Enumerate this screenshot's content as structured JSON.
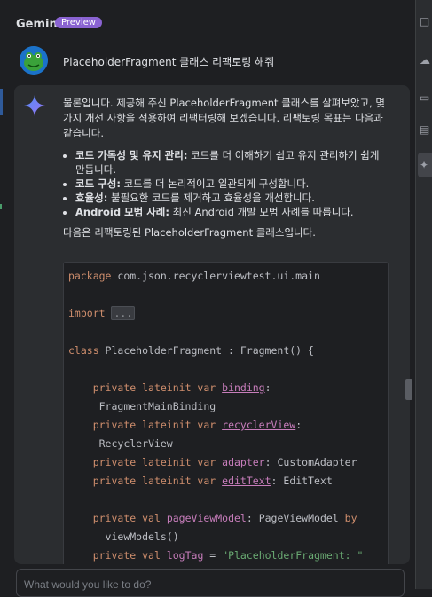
{
  "header": {
    "title": "Gemini",
    "badge": "Preview"
  },
  "user_message": "PlaceholderFragment 클래스 리팩토링 해줘",
  "answer": {
    "intro": "물론입니다. 제공해 주신 PlaceholderFragment 클래스를 살펴보았고, 몇 가지 개선 사항을 적용하여 리팩터링해 보겠습니다. 리팩토링 목표는 다음과 같습니다.",
    "goals": [
      {
        "title": "코드 가독성 및 유지 관리:",
        "text": " 코드를 더 이해하기 쉽고 유지 관리하기 쉽게 만듭니다."
      },
      {
        "title": "코드 구성:",
        "text": " 코드를 더 논리적이고 일관되게 구성합니다."
      },
      {
        "title": "효율성:",
        "text": " 불필요한 코드를 제거하고 효율성을 개선합니다."
      },
      {
        "title": "Android 모범 사례:",
        "text": " 최신 Android 개발 모범 사례를 따릅니다."
      }
    ],
    "outro": "다음은 리팩토링된 PlaceholderFragment 클래스입니다."
  },
  "code": {
    "kw_package": "package",
    "package_name": " com.json.recyclerviewtest.ui.main",
    "kw_import": "import",
    "import_fold": "...",
    "kw_class": "class",
    "class_decl": " PlaceholderFragment : Fragment() {",
    "kw_private": "private",
    "kw_lateinit_var": "lateinit var",
    "kw_val": "val",
    "kw_by": "by",
    "binding_name": "binding",
    "binding_type": "FragmentMainBinding",
    "recycler_name": "recyclerView",
    "recycler_type": "RecyclerView",
    "adapter_name": "adapter",
    "adapter_type": "CustomAdapter",
    "edit_name": "editText",
    "edit_type": "EditText",
    "pvm_name": "pageViewModel",
    "pvm_type": "PageViewModel",
    "pvm_delegate": "viewModels()",
    "logtag_name": "logTag",
    "logtag_value": "\"PlaceholderFragment: \""
  },
  "input": {
    "placeholder": "What would you like to do?"
  },
  "colors": {
    "accent": "#8a63d2",
    "keyword": "#cf8e6d",
    "field": "#c77dbb",
    "string": "#6aab73"
  }
}
